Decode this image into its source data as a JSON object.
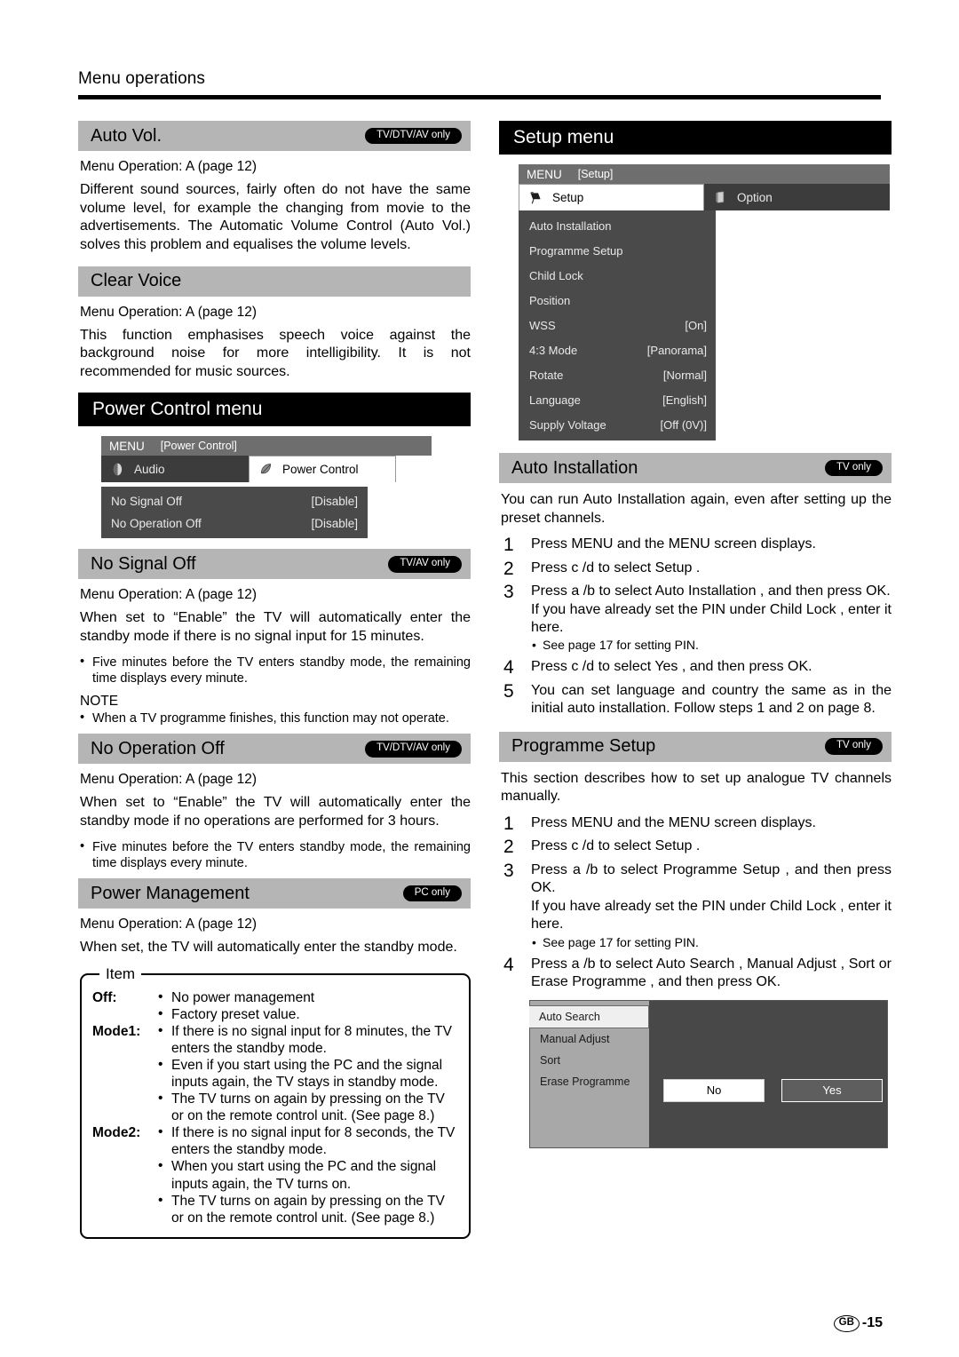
{
  "header": {
    "title": "Menu operations"
  },
  "left": {
    "auto_vol": {
      "heading": "Auto Vol.",
      "badge": "TV/DTV/AV only",
      "operation": "Menu Operation: A (page 12)",
      "body": "Different sound sources, fairly often do not have the same volume level, for example the changing from movie to the advertisements. The Automatic Volume Control (Auto Vol.) solves this problem and equalises the volume levels."
    },
    "clear_voice": {
      "heading": "Clear Voice",
      "operation": "Menu Operation: A (page 12)",
      "body": "This function emphasises speech voice against the background noise for more intelligibility. It is not recommended for music sources."
    },
    "power_control_menu": {
      "heading": "Power Control menu",
      "osd": {
        "menu_label": "MENU",
        "menu_context": "[Power Control]",
        "tabs": [
          {
            "label": "Audio",
            "icon": "speaker-icon",
            "active": false
          },
          {
            "label": "Power Control",
            "icon": "leaf-icon",
            "active": true
          }
        ],
        "rows": [
          {
            "label": "No Signal Off",
            "value": "[Disable]"
          },
          {
            "label": "No Operation Off",
            "value": "[Disable]"
          }
        ]
      }
    },
    "no_signal_off": {
      "heading": "No Signal Off",
      "badge": "TV/AV only",
      "operation": "Menu Operation: A (page 12)",
      "body": "When set to “Enable” the TV will automatically enter the standby mode if there is no signal input for 15 minutes.",
      "bullets": [
        "Five minutes before the TV enters standby mode, the remaining time displays every minute."
      ],
      "note_heading": "NOTE",
      "note_bullets": [
        "When a TV programme finishes, this function may not operate."
      ]
    },
    "no_operation_off": {
      "heading": "No Operation Off",
      "badge": "TV/DTV/AV only",
      "operation": "Menu Operation: A (page 12)",
      "body": "When set to “Enable” the TV will automatically enter the standby mode if no operations are performed for 3 hours.",
      "bullets": [
        "Five minutes before the TV enters standby mode, the remaining time displays every minute."
      ]
    },
    "power_management": {
      "heading": "Power Management",
      "badge": "PC only",
      "operation": "Menu Operation: A (page 12)",
      "body": "When set, the TV will automatically enter the standby mode.",
      "item_box": {
        "legend": "Item",
        "rows": [
          {
            "key": "Off:",
            "bullets": [
              "No power management",
              "Factory preset value."
            ]
          },
          {
            "key": "Mode1:",
            "bullets": [
              "If there is no signal input for 8 minutes, the TV enters the standby mode.",
              "Even if you start using the PC and the signal inputs again, the TV stays in standby mode.",
              "The TV turns on again by pressing     on the TV or       on the remote control unit. (See page 8.)"
            ]
          },
          {
            "key": "Mode2:",
            "bullets": [
              "If there is no signal input for 8 seconds, the TV enters the standby mode.",
              "When you start using the PC and the signal inputs again, the TV turns on.",
              "The TV turns on again by pressing     on the TV or       on the remote control unit. (See page 8.)"
            ]
          }
        ]
      }
    }
  },
  "right": {
    "setup_menu": {
      "heading": "Setup menu",
      "osd": {
        "menu_label": "MENU",
        "menu_context": "[Setup]",
        "tabs": [
          {
            "label": "Setup",
            "icon": "setup-tool-icon",
            "active": true
          },
          {
            "label": "Option",
            "icon": "option-book-icon",
            "active": false
          }
        ],
        "rows": [
          {
            "label": "Auto Installation",
            "value": ""
          },
          {
            "label": "Programme Setup",
            "value": ""
          },
          {
            "label": "Child Lock",
            "value": ""
          },
          {
            "label": "Position",
            "value": ""
          },
          {
            "label": "WSS",
            "value": "[On]"
          },
          {
            "label": "4:3 Mode",
            "value": "[Panorama]"
          },
          {
            "label": "Rotate",
            "value": "[Normal]"
          },
          {
            "label": "Language",
            "value": "[English]"
          },
          {
            "label": "Supply Voltage",
            "value": "[Off (0V)]"
          }
        ]
      }
    },
    "auto_installation": {
      "heading": "Auto Installation",
      "badge": "TV only",
      "body": "You can run Auto Installation again, even after setting up the preset channels.",
      "steps": [
        {
          "num": "1",
          "text": "Press MENU and the MENU screen displays."
        },
        {
          "num": "2",
          "text": "Press c /d  to select  Setup ."
        },
        {
          "num": "3",
          "text": "Press a /b  to select  Auto Installation , and then press OK.",
          "sub": "If you have already set the PIN under  Child Lock , enter it here.",
          "bullets": [
            "See page 17 for setting PIN."
          ]
        },
        {
          "num": "4",
          "text": "Press c /d  to select  Yes , and then press OK."
        },
        {
          "num": "5",
          "text": "You can set language and country the same as in the initial auto installation. Follow steps 1 and 2 on page 8."
        }
      ]
    },
    "programme_setup": {
      "heading": "Programme Setup",
      "badge": "TV only",
      "body": "This section describes how to set up analogue TV channels manually.",
      "steps": [
        {
          "num": "1",
          "text": "Press MENU and the MENU screen displays."
        },
        {
          "num": "2",
          "text": "Press c /d  to select  Setup ."
        },
        {
          "num": "3",
          "text": "Press a /b  to select  Programme Setup , and then press OK.",
          "sub": "If you have already set the PIN under  Child Lock , enter it here.",
          "bullets": [
            "See page 17 for setting PIN."
          ]
        },
        {
          "num": "4",
          "text": "Press a /b  to select  Auto Search ,  Manual Adjust ,  Sort  or  Erase Programme , and then press OK."
        }
      ],
      "tv_screenshot": {
        "items": [
          {
            "label": "Auto Search",
            "selected": true
          },
          {
            "label": "Manual Adjust",
            "selected": false
          },
          {
            "label": "Sort",
            "selected": false
          },
          {
            "label": "Erase Programme",
            "selected": false
          }
        ],
        "buttons": [
          {
            "label": "No",
            "style": "light"
          },
          {
            "label": "Yes",
            "style": "dark"
          }
        ]
      }
    }
  },
  "footer": {
    "region": "GB",
    "page": "-15"
  }
}
